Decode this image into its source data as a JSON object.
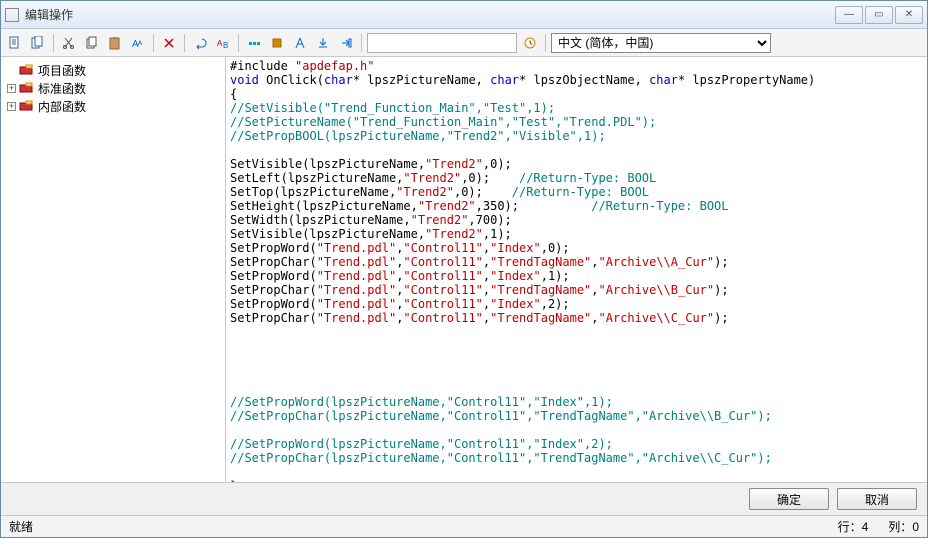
{
  "title": "编辑操作",
  "toolbar": {
    "lang_label": "中文 (简体，中国)"
  },
  "tree": {
    "items": [
      {
        "label": "项目函数",
        "expandable": false
      },
      {
        "label": "标准函数",
        "expandable": true
      },
      {
        "label": "内部函数",
        "expandable": true
      }
    ]
  },
  "code": {
    "lines": [
      [
        [
          "plain",
          "#include "
        ],
        [
          "inc",
          "\"apdefap.h\""
        ]
      ],
      [
        [
          "kw",
          "void"
        ],
        [
          "plain",
          " OnClick("
        ],
        [
          "kw",
          "char"
        ],
        [
          "plain",
          "* lpszPictureName, "
        ],
        [
          "kw",
          "char"
        ],
        [
          "plain",
          "* lpszObjectName, "
        ],
        [
          "kw",
          "char"
        ],
        [
          "plain",
          "* lpszPropertyName)"
        ]
      ],
      [
        [
          "plain",
          "{"
        ]
      ],
      [
        [
          "cmnt",
          "//SetVisible(\"Trend_Function_Main\",\"Test\",1);"
        ]
      ],
      [
        [
          "cmnt",
          "//SetPictureName(\"Trend_Function_Main\",\"Test\",\"Trend.PDL\");"
        ]
      ],
      [
        [
          "cmnt",
          "//SetPropBOOL(lpszPictureName,\"Trend2\",\"Visible\",1);"
        ]
      ],
      [
        [
          "plain",
          " "
        ]
      ],
      [
        [
          "plain",
          "SetVisible(lpszPictureName,"
        ],
        [
          "str",
          "\"Trend2\""
        ],
        [
          "plain",
          ",0);"
        ]
      ],
      [
        [
          "plain",
          "SetLeft(lpszPictureName,"
        ],
        [
          "str",
          "\"Trend2\""
        ],
        [
          "plain",
          ",0);    "
        ],
        [
          "cmnt",
          "//Return-Type: BOOL"
        ]
      ],
      [
        [
          "plain",
          "SetTop(lpszPictureName,"
        ],
        [
          "str",
          "\"Trend2\""
        ],
        [
          "plain",
          ",0);    "
        ],
        [
          "cmnt",
          "//Return-Type: BOOL"
        ]
      ],
      [
        [
          "plain",
          "SetHeight(lpszPictureName,"
        ],
        [
          "str",
          "\"Trend2\""
        ],
        [
          "plain",
          ",350);          "
        ],
        [
          "cmnt",
          "//Return-Type: BOOL"
        ]
      ],
      [
        [
          "plain",
          "SetWidth(lpszPictureName,"
        ],
        [
          "str",
          "\"Trend2\""
        ],
        [
          "plain",
          ",700);"
        ]
      ],
      [
        [
          "plain",
          "SetVisible(lpszPictureName,"
        ],
        [
          "str",
          "\"Trend2\""
        ],
        [
          "plain",
          ",1);"
        ]
      ],
      [
        [
          "plain",
          "SetPropWord("
        ],
        [
          "str",
          "\"Trend.pdl\""
        ],
        [
          "plain",
          ","
        ],
        [
          "str",
          "\"Control11\""
        ],
        [
          "plain",
          ","
        ],
        [
          "str",
          "\"Index\""
        ],
        [
          "plain",
          ",0);"
        ]
      ],
      [
        [
          "plain",
          "SetPropChar("
        ],
        [
          "str",
          "\"Trend.pdl\""
        ],
        [
          "plain",
          ","
        ],
        [
          "str",
          "\"Control11\""
        ],
        [
          "plain",
          ","
        ],
        [
          "str",
          "\"TrendTagName\""
        ],
        [
          "plain",
          ","
        ],
        [
          "str",
          "\"Archive\\\\A_Cur\""
        ],
        [
          "plain",
          ");"
        ]
      ],
      [
        [
          "plain",
          "SetPropWord("
        ],
        [
          "str",
          "\"Trend.pdl\""
        ],
        [
          "plain",
          ","
        ],
        [
          "str",
          "\"Control11\""
        ],
        [
          "plain",
          ","
        ],
        [
          "str",
          "\"Index\""
        ],
        [
          "plain",
          ",1);"
        ]
      ],
      [
        [
          "plain",
          "SetPropChar("
        ],
        [
          "str",
          "\"Trend.pdl\""
        ],
        [
          "plain",
          ","
        ],
        [
          "str",
          "\"Control11\""
        ],
        [
          "plain",
          ","
        ],
        [
          "str",
          "\"TrendTagName\""
        ],
        [
          "plain",
          ","
        ],
        [
          "str",
          "\"Archive\\\\B_Cur\""
        ],
        [
          "plain",
          ");"
        ]
      ],
      [
        [
          "plain",
          "SetPropWord("
        ],
        [
          "str",
          "\"Trend.pdl\""
        ],
        [
          "plain",
          ","
        ],
        [
          "str",
          "\"Control11\""
        ],
        [
          "plain",
          ","
        ],
        [
          "str",
          "\"Index\""
        ],
        [
          "plain",
          ",2);"
        ]
      ],
      [
        [
          "plain",
          "SetPropChar("
        ],
        [
          "str",
          "\"Trend.pdl\""
        ],
        [
          "plain",
          ","
        ],
        [
          "str",
          "\"Control11\""
        ],
        [
          "plain",
          ","
        ],
        [
          "str",
          "\"TrendTagName\""
        ],
        [
          "plain",
          ","
        ],
        [
          "str",
          "\"Archive\\\\C_Cur\""
        ],
        [
          "plain",
          ");"
        ]
      ],
      [
        [
          "plain",
          " "
        ]
      ],
      [
        [
          "plain",
          " "
        ]
      ],
      [
        [
          "plain",
          " "
        ]
      ],
      [
        [
          "plain",
          " "
        ]
      ],
      [
        [
          "plain",
          " "
        ]
      ],
      [
        [
          "cmnt",
          "//SetPropWord(lpszPictureName,\"Control11\",\"Index\",1);"
        ]
      ],
      [
        [
          "cmnt",
          "//SetPropChar(lpszPictureName,\"Control11\",\"TrendTagName\",\"Archive\\\\B_Cur\");"
        ]
      ],
      [
        [
          "plain",
          " "
        ]
      ],
      [
        [
          "cmnt",
          "//SetPropWord(lpszPictureName,\"Control11\",\"Index\",2);"
        ]
      ],
      [
        [
          "cmnt",
          "//SetPropChar(lpszPictureName,\"Control11\",\"TrendTagName\",\"Archive\\\\C_Cur\");"
        ]
      ],
      [
        [
          "plain",
          " "
        ]
      ],
      [
        [
          "plain",
          "}"
        ]
      ]
    ]
  },
  "buttons": {
    "ok": "确定",
    "cancel": "取消"
  },
  "status": {
    "ready": "就绪",
    "row_label": "行：",
    "row": "4",
    "col_label": "列：",
    "col": "0"
  }
}
